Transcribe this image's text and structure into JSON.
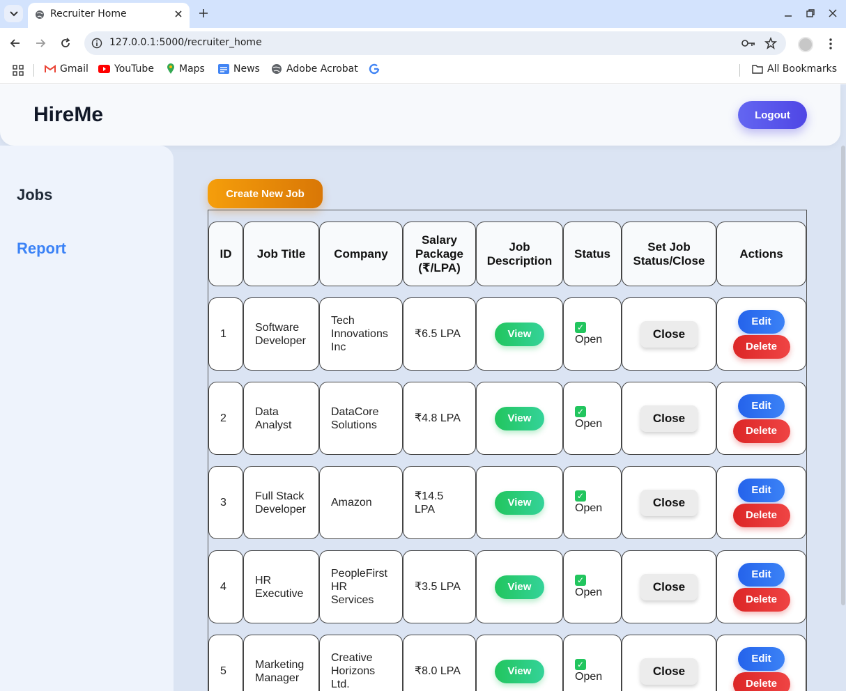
{
  "browser": {
    "tab_title": "Recruiter Home",
    "url": "127.0.0.1:5000/recruiter_home",
    "bookmarks": [
      "Gmail",
      "YouTube",
      "Maps",
      "News",
      "Adobe Acrobat"
    ],
    "all_bookmarks": "All Bookmarks"
  },
  "header": {
    "brand": "HireMe",
    "logout_label": "Logout"
  },
  "sidebar": {
    "items": [
      {
        "label": "Jobs"
      },
      {
        "label": "Report"
      }
    ]
  },
  "main": {
    "create_label": "Create New Job",
    "columns": [
      "ID",
      "Job Title",
      "Company",
      "Salary Package (₹/LPA)",
      "Job Description",
      "Status",
      "Set Job Status/Close",
      "Actions"
    ],
    "rows": [
      {
        "id": "1",
        "title": "Software Developer",
        "company": "Tech Innovations Inc",
        "salary": "₹6.5 LPA",
        "view": "View",
        "status": "Open",
        "close": "Close",
        "edit": "Edit",
        "delete": "Delete"
      },
      {
        "id": "2",
        "title": "Data Analyst",
        "company": "DataCore Solutions",
        "salary": "₹4.8 LPA",
        "view": "View",
        "status": "Open",
        "close": "Close",
        "edit": "Edit",
        "delete": "Delete"
      },
      {
        "id": "3",
        "title": "Full Stack Developer",
        "company": "Amazon",
        "salary": "₹14.5 LPA",
        "view": "View",
        "status": "Open",
        "close": "Close",
        "edit": "Edit",
        "delete": "Delete"
      },
      {
        "id": "4",
        "title": "HR Executive",
        "company": "PeopleFirst HR Services",
        "salary": "₹3.5 LPA",
        "view": "View",
        "status": "Open",
        "close": "Close",
        "edit": "Edit",
        "delete": "Delete"
      },
      {
        "id": "5",
        "title": "Marketing Manager",
        "company": "Creative Horizons Ltd.",
        "salary": "₹8.0 LPA",
        "view": "View",
        "status": "Open",
        "close": "Close",
        "edit": "Edit",
        "delete": "Delete"
      }
    ]
  }
}
